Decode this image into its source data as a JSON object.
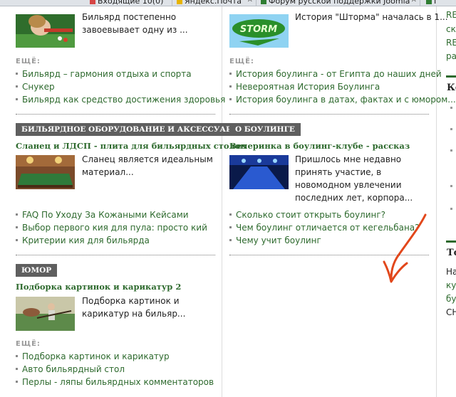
{
  "tabs": [
    {
      "label": "Входящие 10(0)",
      "color": "#d64545"
    },
    {
      "label": "Яндекс.Почта",
      "color": "#e7b400"
    },
    {
      "label": "Форум русской поддержки Joomla",
      "color": "#2f7d32"
    },
    {
      "label": "Г",
      "color": "#2f7d32"
    }
  ],
  "col1": {
    "sec1": {
      "lead": "Бильярд постепенно завоевывает одну из ...",
      "more_label": "ЕЩЁ:",
      "links": [
        "Бильярд – гармония отдыха и спорта",
        "Снукер",
        "Бильярд как средство достижения здоровья"
      ]
    },
    "sec2": {
      "category": "Бильярдное оборудование и аксессуары",
      "title": "Сланец и ЛДСП - плита для бильярдных столов",
      "lead": "Сланец является идеальным материал...",
      "links": [
        "FAQ По Уходу За Кожаными Кейсами",
        "Выбор первого кия для пула: просто кий",
        "Критерии кия для бильярда"
      ]
    },
    "sec3": {
      "category": "Юмор",
      "title": "Подборка картинок и карикатур 2",
      "lead": "Подборка картинок и карикатур на бильяр...",
      "more_label": "ЕЩЁ:",
      "links": [
        "Подборка картинок и карикатур",
        "Авто бильярдный стол",
        "Перлы - ляпы бильярдных комментаторов"
      ]
    }
  },
  "col2": {
    "sec1": {
      "lead": "История \"Шторма\" началась в 1...",
      "logo_text": "STORM",
      "more_label": "ЕЩЁ:",
      "links": [
        "История боулинга - от Египта до наших дней",
        "Невероятная История Боулинга",
        "История боулинга в датах, фактах и с юмором..."
      ]
    },
    "sec2": {
      "category": "О боулинге",
      "title": "Вечеринка в боулинг-клубе - рассказ",
      "lead": "Пришлось мне недавно принять участие, в новомодном увлечении последних лет, корпора...",
      "links": [
        "Сколько стоит открыть боулинг?",
        "Чем боулинг отличается от кегельбана?",
        "Чему учит боулинг"
      ]
    }
  },
  "right": {
    "frag_top": [
      "RE",
      "ска",
      "RE",
      "ра"
    ],
    "heading1": "Ко",
    "heading2": "То",
    "frag_bottom": [
      "На",
      "кур",
      "бун",
      "СН"
    ]
  },
  "colors": {
    "link_green": "#2e6a2e",
    "category_bg": "#5f5f5f",
    "arrow": "#e2471b"
  }
}
